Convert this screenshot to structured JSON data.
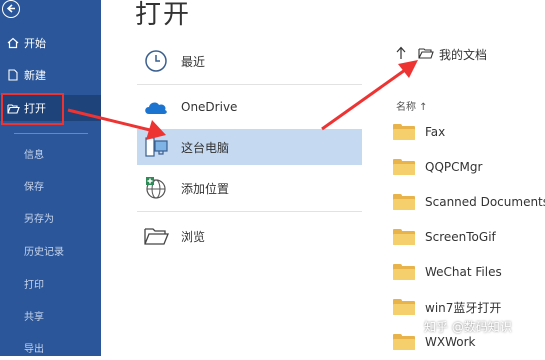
{
  "page": {
    "title": "打开"
  },
  "sidebar": {
    "items": [
      {
        "label": "开始"
      },
      {
        "label": "新建"
      },
      {
        "label": "打开"
      }
    ],
    "sub_items": [
      {
        "label": "信息"
      },
      {
        "label": "保存"
      },
      {
        "label": "另存为"
      },
      {
        "label": "历史记录"
      },
      {
        "label": "打印"
      },
      {
        "label": "共享"
      },
      {
        "label": "导出"
      }
    ]
  },
  "locations": [
    {
      "label": "最近",
      "icon": "clock-icon"
    },
    {
      "label": "OneDrive",
      "icon": "cloud-icon"
    },
    {
      "label": "这台电脑",
      "icon": "computer-icon"
    },
    {
      "label": "添加位置",
      "icon": "globe-plus-icon"
    },
    {
      "label": "浏览",
      "icon": "folder-open-icon"
    }
  ],
  "right_panel": {
    "path": "我的文档",
    "sort_label": "名称 ↑",
    "files": [
      {
        "name": "Fax"
      },
      {
        "name": "QQPCMgr"
      },
      {
        "name": "Scanned Documents"
      },
      {
        "name": "ScreenToGif"
      },
      {
        "name": "WeChat Files"
      },
      {
        "name": "win7蓝牙打开"
      },
      {
        "name": "WXWork"
      }
    ]
  },
  "watermark": "知乎 @数码知识",
  "colors": {
    "sidebar": "#2b579a",
    "selected": "#c5d9f1",
    "annotation": "#e33333",
    "folder": "#e8b34a"
  }
}
